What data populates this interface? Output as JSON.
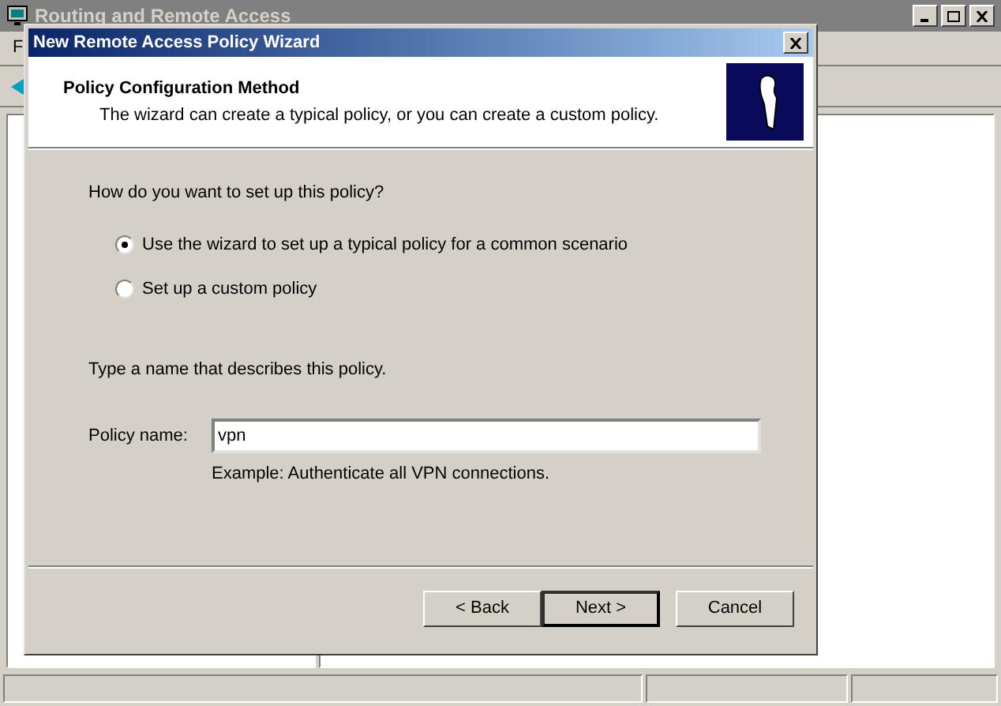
{
  "background_window": {
    "title": "Routing and Remote Access",
    "menu": [
      "F"
    ]
  },
  "dialog": {
    "title": "New Remote Access Policy Wizard",
    "heading": "Policy Configuration Method",
    "subheading": "The wizard can create a typical policy, or you can create a custom policy.",
    "question": "How do you want to set up this policy?",
    "options": [
      {
        "label": "Use the wizard to set up a typical policy for a common scenario",
        "selected": true
      },
      {
        "label": "Set up a custom policy",
        "selected": false
      }
    ],
    "name_prompt": "Type a name that describes this policy.",
    "policy_name": {
      "label": "Policy name:",
      "value": "vpn"
    },
    "example": "Example: Authenticate all VPN connections.",
    "buttons": [
      {
        "label": "< Back",
        "default": false
      },
      {
        "label": "Next >",
        "default": true
      },
      {
        "label": "Cancel",
        "default": false
      }
    ]
  }
}
